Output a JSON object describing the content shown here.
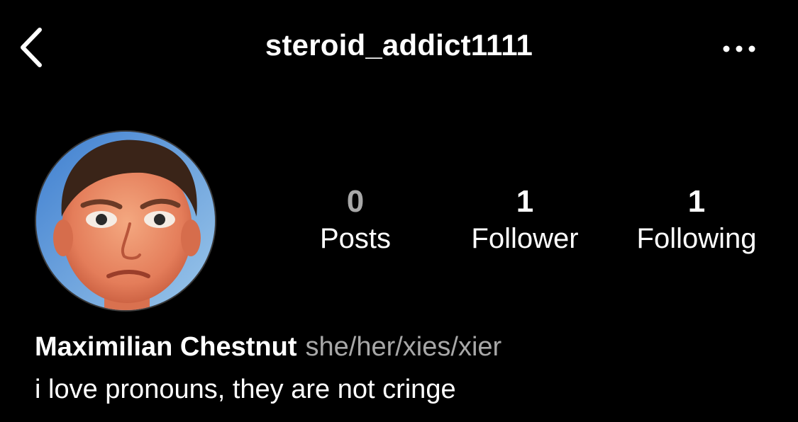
{
  "header": {
    "username": "steroid_addict1111",
    "back_icon": "chevron-left-icon",
    "more_icon": "ellipsis-horizontal-icon"
  },
  "profile": {
    "avatar_icon": "profile-photo",
    "stats": {
      "posts": {
        "count": "0",
        "label": "Posts"
      },
      "followers": {
        "count": "1",
        "label": "Follower"
      },
      "following": {
        "count": "1",
        "label": "Following"
      }
    },
    "name": "Maximilian Chestnut",
    "pronouns": "she/her/xies/xier",
    "bio": "i love pronouns, they are not cringe"
  },
  "colors": {
    "background": "#000000",
    "text": "#ffffff",
    "muted_text": "#a8a8a8"
  }
}
